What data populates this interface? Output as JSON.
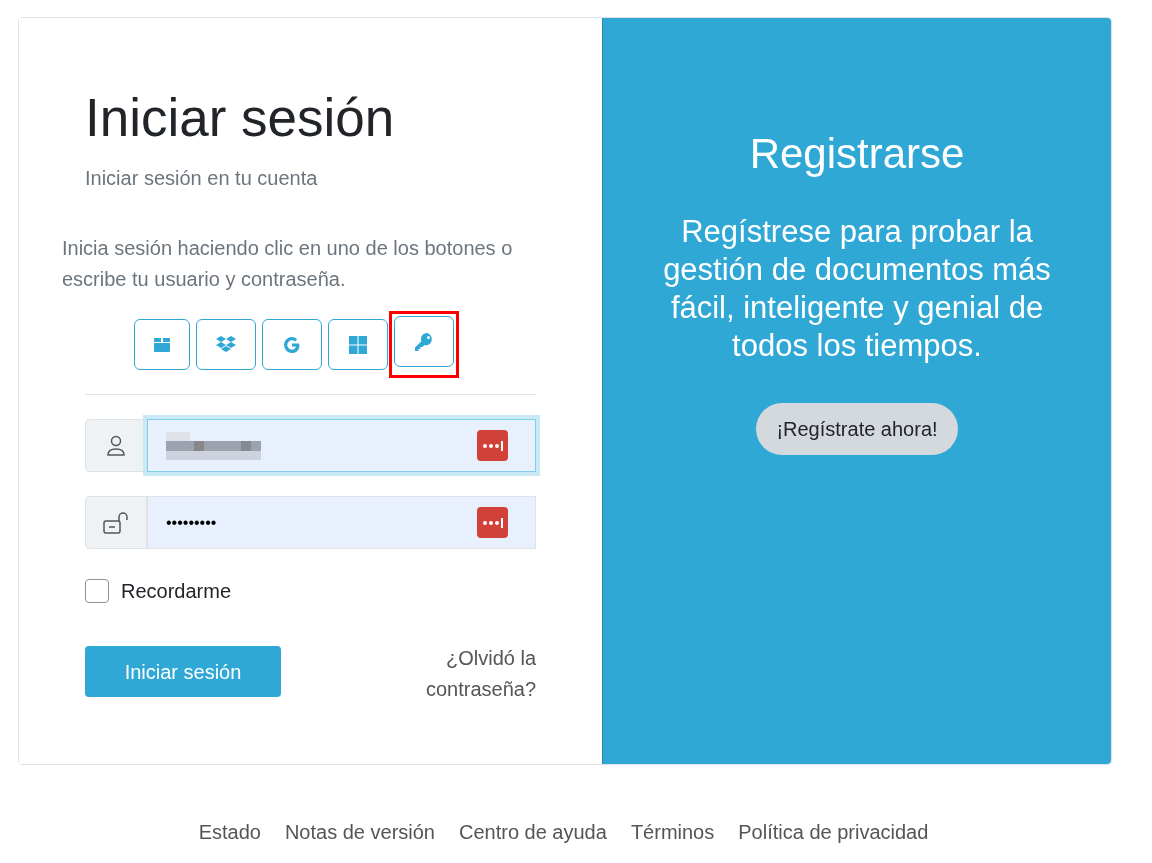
{
  "login": {
    "title": "Iniciar sesión",
    "subtitle": "Iniciar sesión en tu cuenta",
    "intro": "Inicia sesión haciendo clic en uno de los botones o escribe tu usuario y contraseña.",
    "providers": [
      {
        "kind": "box",
        "highlighted": false
      },
      {
        "kind": "dropbox",
        "highlighted": false
      },
      {
        "kind": "google",
        "highlighted": false
      },
      {
        "kind": "windows",
        "highlighted": false
      },
      {
        "kind": "key",
        "highlighted": true
      }
    ],
    "username": {
      "kind": "redacted",
      "focused": true
    },
    "password": {
      "value": "•••••••••",
      "focused": false
    },
    "remember": {
      "label": "Recordarme",
      "checked": false
    },
    "submit": "Iniciar sesión",
    "forgot": "¿Olvidó la contraseña?"
  },
  "signup": {
    "title": "Registrarse",
    "text": "Regístrese para probar la gestión de documentos más fácil, inteligente y genial de todos los tiempos.",
    "button": "¡Regístrate ahora!"
  },
  "footer": [
    "Estado",
    "Notas de versión",
    "Centro de ayuda",
    "Términos",
    "Política de privacidad"
  ]
}
